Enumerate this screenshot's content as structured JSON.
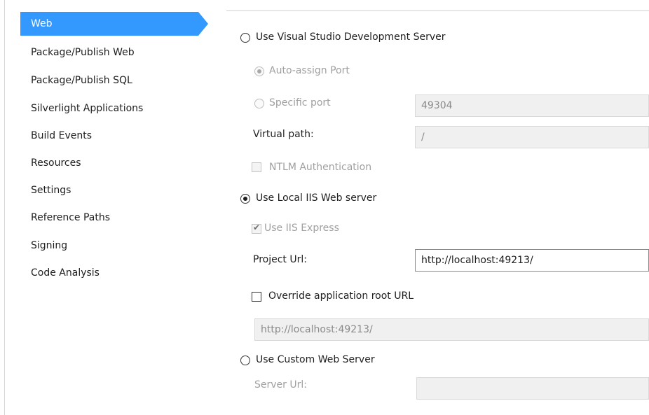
{
  "sidebar": {
    "items": [
      {
        "label": "Web"
      },
      {
        "label": "Package/Publish Web"
      },
      {
        "label": "Package/Publish SQL"
      },
      {
        "label": "Silverlight Applications"
      },
      {
        "label": "Build Events"
      },
      {
        "label": "Resources"
      },
      {
        "label": "Settings"
      },
      {
        "label": "Reference Paths"
      },
      {
        "label": "Signing"
      },
      {
        "label": "Code Analysis"
      }
    ]
  },
  "web": {
    "vs_dev_server_label": "Use Visual Studio Development Server",
    "auto_assign_port_label": "Auto-assign Port",
    "specific_port_label": "Specific port",
    "specific_port_value": "49304",
    "virtual_path_label": "Virtual path:",
    "virtual_path_value": "/",
    "ntlm_label": "NTLM Authentication",
    "local_iis_label": "Use Local IIS Web server",
    "use_iis_express_label": "Use IIS Express",
    "project_url_label": "Project Url:",
    "project_url_value": "http://localhost:49213/",
    "override_root_label": "Override application root URL",
    "override_root_value": "http://localhost:49213/",
    "custom_server_label": "Use Custom Web Server",
    "server_url_label": "Server Url:",
    "server_url_value": ""
  },
  "colors": {
    "selection": "#3399ff"
  }
}
